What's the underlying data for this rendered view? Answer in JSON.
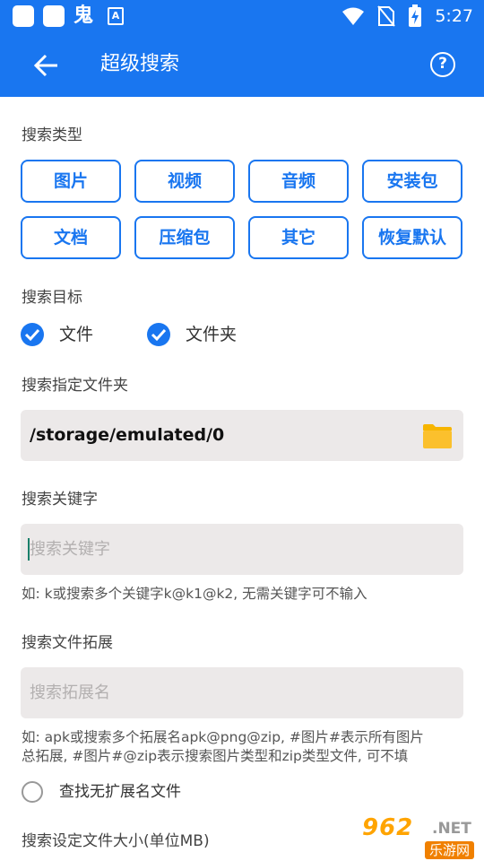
{
  "status_bar": {
    "carrier_glyph": "鬼",
    "a_icon": "A",
    "time": "5:27",
    "icons": [
      "app-square-icon",
      "app-square-icon",
      "ghost-icon",
      "a-notification-icon",
      "wifi-icon",
      "no-sim-icon",
      "battery-charging-icon"
    ]
  },
  "app_bar": {
    "title": "超级搜索",
    "back_icon": "arrow-left-icon",
    "help_icon": "question-circle-icon",
    "help_glyph": "?"
  },
  "search_type": {
    "label": "搜索类型",
    "chips": [
      "图片",
      "视频",
      "音频",
      "安装包",
      "文档",
      "压缩包",
      "其它",
      "恢复默认"
    ]
  },
  "search_target": {
    "label": "搜索目标",
    "options": [
      {
        "label": "文件",
        "checked": true
      },
      {
        "label": "文件夹",
        "checked": true
      }
    ]
  },
  "folder": {
    "label": "搜索指定文件夹",
    "path": "/storage/emulated/0",
    "icon": "folder-icon"
  },
  "keyword": {
    "label": "搜索关键字",
    "placeholder": "搜索关键字",
    "value": "",
    "hint": "如: k或搜索多个关键字k@k1@k2, 无需关键字可不输入"
  },
  "extension": {
    "label": "搜索文件拓展",
    "placeholder": "搜索拓展名",
    "value": "",
    "hint_line1": "如: apk或搜索多个拓展名apk@png@zip, #图片#表示所有图片",
    "hint_line2": "总拓展, #图片#@zip表示搜索图片类型和zip类型文件, 可不填",
    "no_ext_label": "查找无扩展名文件",
    "no_ext_checked": false
  },
  "size": {
    "label": "搜索设定文件大小(单位MB)"
  },
  "watermark": {
    "top": "962",
    "net": ".NET",
    "bottom": "乐游网"
  },
  "colors": {
    "primary": "#1976f0",
    "field_bg": "#ece9e9",
    "folder_yellow": "#f7b500"
  }
}
